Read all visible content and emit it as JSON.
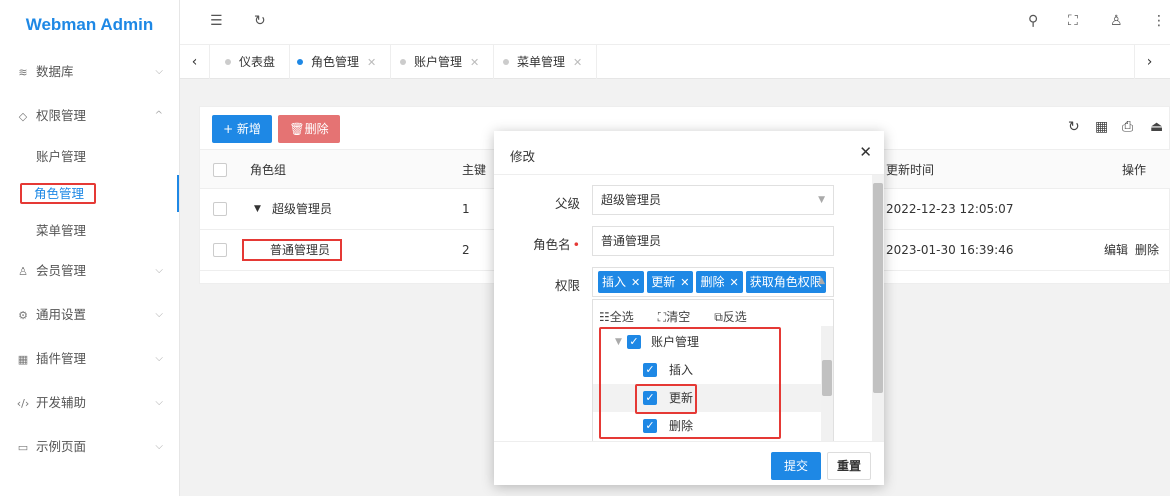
{
  "app": {
    "title": "Webman Admin"
  },
  "sidebar": {
    "groups": [
      {
        "label": "数据库",
        "icon": "layers-icon"
      },
      {
        "label": "权限管理",
        "icon": "shield-icon",
        "expanded": true,
        "children": [
          {
            "label": "账户管理"
          },
          {
            "label": "角色管理",
            "active": true
          },
          {
            "label": "菜单管理"
          }
        ]
      },
      {
        "label": "会员管理",
        "icon": "user-icon"
      },
      {
        "label": "通用设置",
        "icon": "gear-icon"
      },
      {
        "label": "插件管理",
        "icon": "plugin-icon"
      },
      {
        "label": "开发辅助",
        "icon": "code-icon"
      },
      {
        "label": "示例页面",
        "icon": "page-icon"
      }
    ]
  },
  "tabs": [
    {
      "label": "仪表盘",
      "active": false
    },
    {
      "label": "角色管理",
      "active": true
    },
    {
      "label": "账户管理",
      "active": false
    },
    {
      "label": "菜单管理",
      "active": false
    }
  ],
  "toolbar": {
    "add_label": "+ 新增",
    "delete_label": "🗑删除"
  },
  "table": {
    "headers": {
      "role_group": "角色组",
      "id": "主键",
      "updated": "更新时间",
      "actions": "操作"
    },
    "rows": [
      {
        "name": "超级管理员",
        "id": "1",
        "updated": "2022-12-23 12:05:07",
        "expand": "▼"
      },
      {
        "name": "普通管理员",
        "id": "2",
        "updated": "2023-01-30 16:39:46",
        "edit": "编辑",
        "delete": "删除"
      }
    ]
  },
  "modal": {
    "title": "修改",
    "parent_label": "父级",
    "parent_value": "超级管理员",
    "name_label": "角色名",
    "name_value": "普通管理员",
    "perm_label": "权限",
    "perm_tags": [
      "插入",
      "更新",
      "删除",
      "获取角色权限"
    ],
    "tree_tools": {
      "select_all": "全选",
      "clear": "清空",
      "invert": "反选"
    },
    "tree": [
      {
        "label": "账户管理",
        "level": 0,
        "checked": true
      },
      {
        "label": "插入",
        "level": 1,
        "checked": true
      },
      {
        "label": "更新",
        "level": 1,
        "checked": true
      },
      {
        "label": "删除",
        "level": 1,
        "checked": true
      }
    ],
    "submit_label": "提交",
    "reset_label": "重置"
  },
  "colors": {
    "primary": "#1e88e5",
    "danger": "#e57373",
    "highlight": "#e53935"
  }
}
